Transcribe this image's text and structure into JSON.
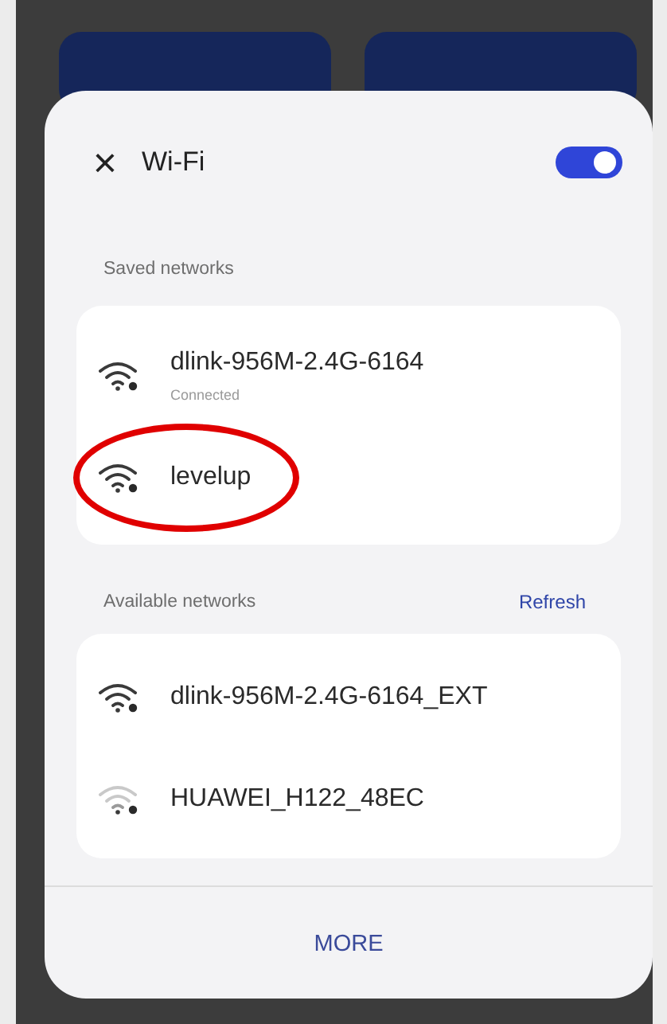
{
  "header": {
    "close_glyph": "×",
    "title": "Wi-Fi",
    "wifi_on": true
  },
  "sections": [
    {
      "title": "Saved networks",
      "networks": [
        {
          "name": "dlink-956M-2.4G-6164",
          "status": "Connected",
          "weak_signal": false,
          "highlighted": false
        },
        {
          "name": "levelup",
          "weak_signal": false,
          "highlighted": true
        }
      ]
    },
    {
      "title": "Available networks",
      "action": "Refresh",
      "networks": [
        {
          "name": "dlink-956M-2.4G-6164_EXT",
          "weak_signal": false,
          "highlighted": false
        },
        {
          "name": "HUAWEI_H122_48EC",
          "weak_signal": true,
          "highlighted": false
        }
      ]
    }
  ],
  "more_button": "MORE"
}
